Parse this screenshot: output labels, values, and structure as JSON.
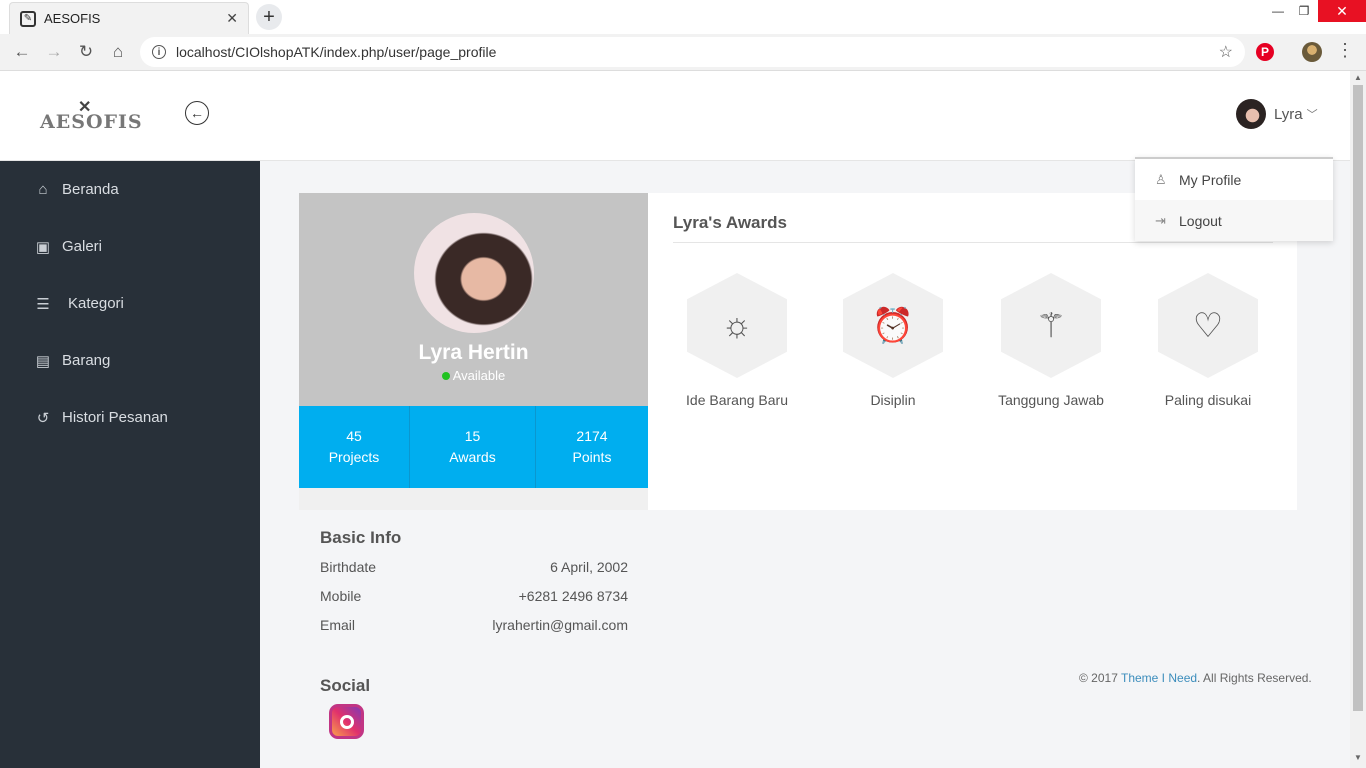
{
  "browser": {
    "tab_title": "AESOFIS",
    "tab_close": "✕",
    "new_tab": "+",
    "url": "localhost/CIOlshopATK/index.php/user/page_profile",
    "win_min": "—",
    "win_max": "❐",
    "win_close": "✕"
  },
  "header": {
    "logo_text": "AESOFIS",
    "user_name": "Lyra",
    "dropdown": [
      {
        "label": "My Profile",
        "icon": "user-icon"
      },
      {
        "label": "Logout",
        "icon": "logout-icon"
      }
    ]
  },
  "sidebar": {
    "items": [
      {
        "label": "Beranda",
        "icon": "home-icon"
      },
      {
        "label": "Galeri",
        "icon": "image-icon"
      },
      {
        "label": "Kategori",
        "icon": "list-icon"
      },
      {
        "label": "Barang",
        "icon": "box-icon"
      },
      {
        "label": "Histori Pesanan",
        "icon": "history-icon"
      }
    ]
  },
  "profile": {
    "name": "Lyra Hertin",
    "status": "Available",
    "stats": [
      {
        "value": "45",
        "label": "Projects"
      },
      {
        "value": "15",
        "label": "Awards"
      },
      {
        "value": "2174",
        "label": "Points"
      }
    ]
  },
  "awards": {
    "title": "Lyra's Awards",
    "items": [
      {
        "label": "Ide Barang Baru",
        "icon": "sun-icon"
      },
      {
        "label": "Disiplin",
        "icon": "alarm-clock-icon"
      },
      {
        "label": "Tanggung Jawab",
        "icon": "magic-wand-icon"
      },
      {
        "label": "Paling disukai",
        "icon": "heart-icon"
      }
    ]
  },
  "basic_info": {
    "title": "Basic Info",
    "rows": [
      {
        "label": "Birthdate",
        "value": "6 April, 2002"
      },
      {
        "label": "Mobile",
        "value": "+6281 2496 8734"
      },
      {
        "label": "Email",
        "value": "lyrahertin@gmail.com"
      }
    ]
  },
  "social": {
    "title": "Social",
    "icon": "instagram-icon"
  },
  "footer": {
    "prefix": "© 2017 ",
    "link": "Theme I Need",
    "suffix": ". All Rights Reserved."
  }
}
